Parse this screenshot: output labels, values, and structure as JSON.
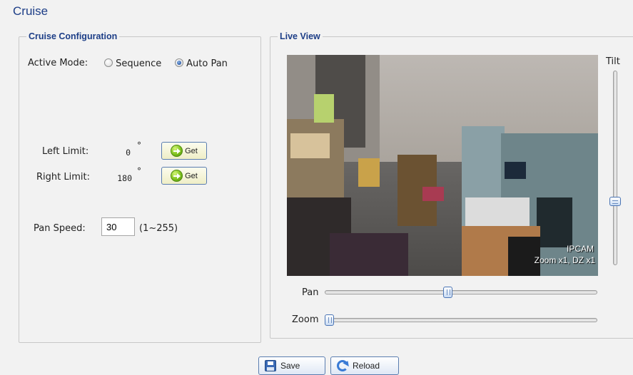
{
  "page": {
    "title": "Cruise"
  },
  "cruise_config": {
    "legend": "Cruise Configuration",
    "active_mode": {
      "label": "Active Mode:",
      "options": [
        "Sequence",
        "Auto Pan"
      ],
      "selected": "Auto Pan"
    },
    "left_limit": {
      "label": "Left Limit:",
      "value": "0",
      "unit": "°",
      "button": "Get"
    },
    "right_limit": {
      "label": "Right Limit:",
      "value": "180",
      "unit": "°",
      "button": "Get"
    },
    "pan_speed": {
      "label": "Pan Speed:",
      "value": "30",
      "range": "(1~255)"
    }
  },
  "live_view": {
    "legend": "Live View",
    "camera_name": "IPCAM",
    "zoom_overlay": "Zoom x1, DZ x1",
    "tilt_label": "Tilt",
    "pan_label": "Pan",
    "zoom_label": "Zoom",
    "pan_position": 0.45,
    "zoom_position": 0.0,
    "tilt_position": 0.68
  },
  "footer": {
    "save_label": "Save",
    "reload_label": "Reload"
  },
  "icons": {
    "get": "play-arrow-icon",
    "save": "floppy-disk-icon",
    "reload": "refresh-icon"
  },
  "colors": {
    "accent": "#1d3e87",
    "background": "#f2f2f2",
    "button_border": "#5a7db0"
  }
}
